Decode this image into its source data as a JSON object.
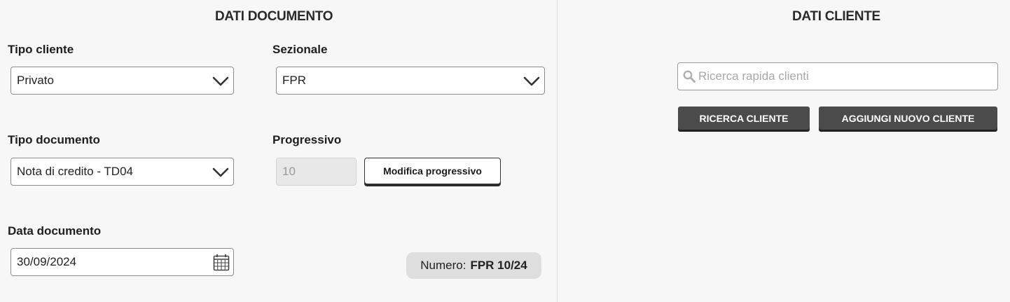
{
  "documento": {
    "title": "DATI DOCUMENTO",
    "tipo_cliente": {
      "label": "Tipo cliente",
      "value": "Privato"
    },
    "sezionale": {
      "label": "Sezionale",
      "value": "FPR"
    },
    "tipo_documento": {
      "label": "Tipo documento",
      "value": "Nota di credito - TD04"
    },
    "progressivo": {
      "label": "Progressivo",
      "value": "10",
      "button": "Modifica progressivo"
    },
    "data_documento": {
      "label": "Data documento",
      "value": "30/09/2024"
    },
    "numero": {
      "label": "Numero:",
      "value": "FPR 10/24"
    }
  },
  "cliente": {
    "title": "DATI CLIENTE",
    "search_placeholder": "Ricerca rapida clienti",
    "ricerca_button": "RICERCA CLIENTE",
    "aggiungi_button": "AGGIUNGI NUOVO CLIENTE"
  },
  "icons": {
    "dropdown": "chevron-down-icon",
    "calendar": "calendar-icon",
    "search": "search-icon"
  }
}
